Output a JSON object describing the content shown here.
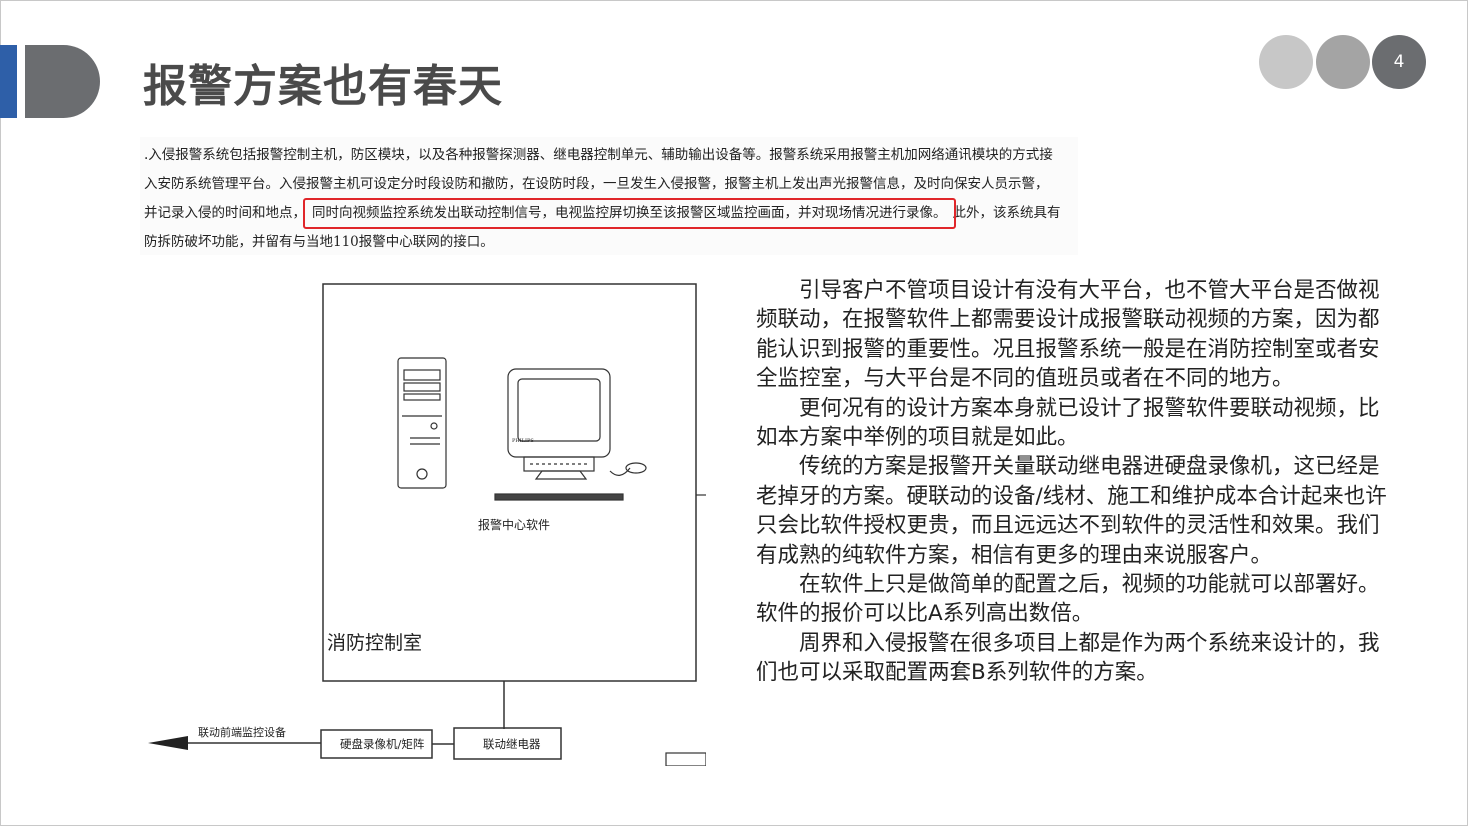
{
  "slide": {
    "title": "报警方案也有春天",
    "page_number": "4"
  },
  "scan_excerpt": {
    "lines": [
      ".入侵报警系统包括报警控制主机，防区模块，以及各种报警探测器、继电器控制单元、辅助输出设备等。报警系统采用报警主机加网络通讯模块的方式接",
      "入安防系统管理平台。入侵报警主机可设定分时段设防和撤防，在设防时段，一旦发生入侵报警，报警主机上发出声光报警信息，及时向保安人员示警，",
      "并记录入侵的时间和地点，",
      "防拆防破坏功能，并留有与当地110报警中心联网的接口。"
    ],
    "highlighted": "同时向视频监控系统发出联动控制信号，电视监控屏切换至该报警区域监控画面，并对现场情况进行录像。",
    "line3_tail": "此外，该系统具有"
  },
  "diagram": {
    "software_label": "报警中心软件",
    "room_label": "消防控制室",
    "arrow_label": "联动前端监控设备",
    "box1_label": "硬盘录像机/矩阵",
    "box2_label": "联动继电器",
    "monitor_brand": "PHILIPS"
  },
  "body": {
    "paragraphs": [
      "引导客户不管项目设计有没有大平台，也不管大平台是否做视频联动，在报警软件上都需要设计成报警联动视频的方案，因为都能认识到报警的重要性。况且报警系统一般是在消防控制室或者安全监控室，与大平台是不同的值班员或者在不同的地方。",
      "更何况有的设计方案本身就已设计了报警软件要联动视频，比如本方案中举例的项目就是如此。",
      "传统的方案是报警开关量联动继电器进硬盘录像机，这已经是老掉牙的方案。硬联动的设备/线材、施工和维护成本合计起来也许只会比软件授权更贵，而且远远达不到软件的灵活性和效果。我们有成熟的纯软件方案，相信有更多的理由来说服客户。",
      "在软件上只是做简单的配置之后，视频的功能就可以部署好。软件的报价可以比A系列高出数倍。",
      "周界和入侵报警在很多项目上都是作为两个系统来设计的，我们也可以采取配置两套B系列软件的方案。"
    ]
  },
  "colors": {
    "accent_blue": "#2e5fa8",
    "dark_gray": "#6b6d70",
    "highlight_red": "#e0262a"
  }
}
